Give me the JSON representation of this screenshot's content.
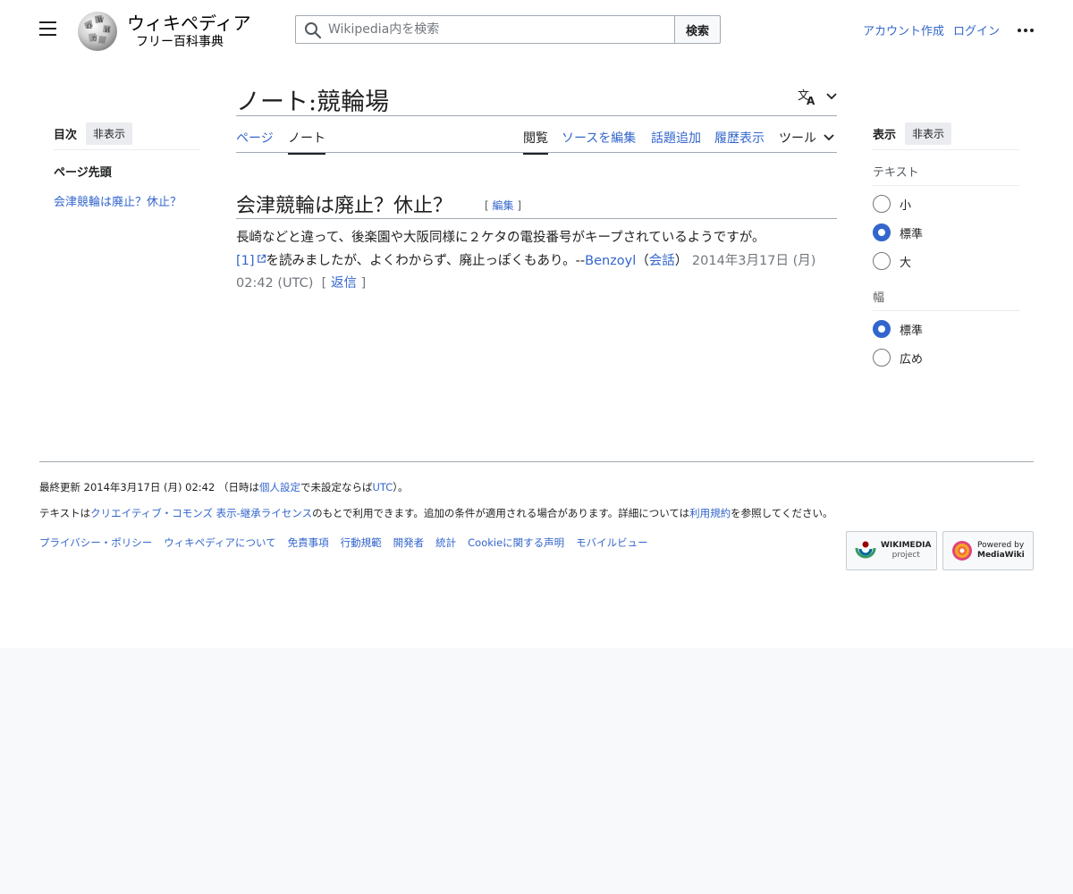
{
  "header": {
    "wordmark": "ウィキペディア",
    "tagline": "フリー百科事典",
    "search_placeholder": "Wikipedia内を検索",
    "search_button": "検索",
    "create_account": "アカウント作成",
    "login": "ログイン"
  },
  "toc": {
    "title": "目次",
    "hide": "非表示",
    "top": "ページ先頭",
    "items": [
      "会津競輪は廃止？休止？"
    ]
  },
  "page": {
    "title": "ノート:競輪場",
    "tabs": {
      "page": "ページ",
      "talk": "ノート",
      "read": "閲覧",
      "edit_source": "ソースを編集",
      "add_topic": "話題追加",
      "history": "履歴表示",
      "tools": "ツール"
    }
  },
  "section": {
    "title": "会津競輪は廃止？休止？",
    "edit": "編集"
  },
  "comment": {
    "line1": "長崎などと違って、後楽園や大阪同様に２ケタの電投番号がキープされているようですが。",
    "ref": "[1]",
    "text2": "を読みましたが、よくわからず、廃止っぽくもあり。--",
    "user": "Benzoyl",
    "paren_open": "（",
    "talk": "会話",
    "paren_close": "）",
    "timestamp": "2014年3月17日 (月) 02:42 (UTC)",
    "reply": "返信"
  },
  "appearance": {
    "title": "表示",
    "hide": "非表示",
    "text_label": "テキスト",
    "text_options": [
      {
        "label": "小",
        "selected": false
      },
      {
        "label": "標準",
        "selected": true
      },
      {
        "label": "大",
        "selected": false
      }
    ],
    "width_label": "幅",
    "width_options": [
      {
        "label": "標準",
        "selected": true
      },
      {
        "label": "広め",
        "selected": false
      }
    ]
  },
  "footer": {
    "last_edit_prefix": "最終更新 2014年3月17日 (月) 02:42 （日時は",
    "personal_settings": "個人設定",
    "last_edit_middle": "で未設定ならば",
    "utc": "UTC",
    "last_edit_suffix": "）。",
    "license_prefix": "テキストは",
    "license_link": "クリエイティブ・コモンズ 表示-継承ライセンス",
    "license_middle": "のもとで利用できます。追加の条件が適用される場合があります。詳細については",
    "terms_link": "利用規約",
    "license_suffix": "を参照してください。",
    "links": [
      "プライバシー・ポリシー",
      "ウィキペディアについて",
      "免責事項",
      "行動規範",
      "開発者",
      "統計",
      "Cookieに関する声明",
      "モバイルビュー"
    ],
    "badge_wikimedia": [
      "WIKIMEDIA",
      "project"
    ],
    "badge_mediawiki": [
      "Powered by",
      "MediaWiki"
    ]
  },
  "colors": {
    "link": "#3366cc",
    "text": "#202122",
    "border": "#a2a9b1",
    "radio_selected": "#3366cc"
  }
}
